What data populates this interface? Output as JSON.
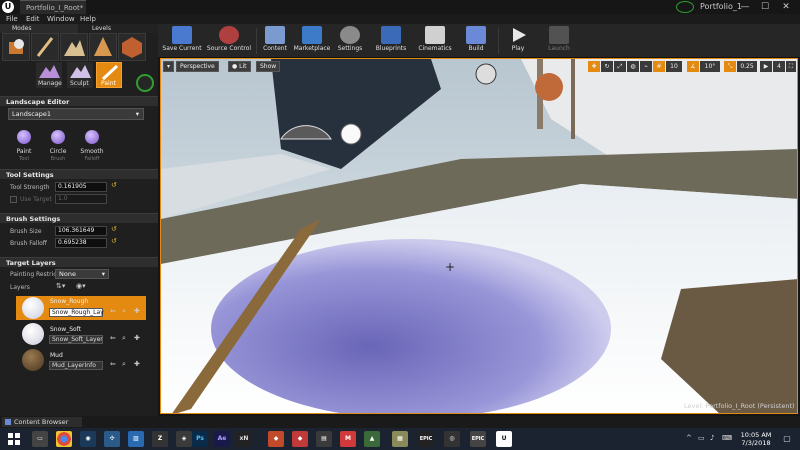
{
  "window": {
    "tab_title": "Portfolio_I_Root*",
    "project_name": "Portfolio_1",
    "controls": {
      "minimize": "—",
      "maximize": "☐",
      "close": "✕"
    }
  },
  "menu": [
    "File",
    "Edit",
    "Window",
    "Help"
  ],
  "panel_tabs": {
    "modes": "Modes",
    "levels": "Levels"
  },
  "modes": {
    "manage": "Manage",
    "sculpt": "Sculpt",
    "paint": "Paint"
  },
  "landscape_editor": {
    "title": "Landscape Editor",
    "selected_landscape": "Landscape1",
    "tools": [
      {
        "label": "Paint",
        "sub": "Tool"
      },
      {
        "label": "Circle",
        "sub": "Brush"
      },
      {
        "label": "Smooth",
        "sub": "Falloff"
      }
    ]
  },
  "tool_settings": {
    "title": "Tool Settings",
    "strength_label": "Tool Strength",
    "strength_value": "0.161905",
    "target_label": "Use Target",
    "target_value": "1.0"
  },
  "brush_settings": {
    "title": "Brush Settings",
    "size_label": "Brush Size",
    "size_value": "106.361649",
    "falloff_label": "Brush Falloff",
    "falloff_value": "0.695238"
  },
  "target_layers": {
    "title": "Target Layers",
    "painting_restriction_label": "Painting Restric",
    "painting_restriction_value": "None",
    "layers_label": "Layers",
    "layers": [
      {
        "name": "Snow_Rough",
        "info": "Snow_Rough_Lay",
        "selected": true
      },
      {
        "name": "Snow_Soft",
        "info": "Snow_Soft_Layer"
      },
      {
        "name": "Mud",
        "info": "Mud_LayerInfo"
      }
    ]
  },
  "toolbar": {
    "buttons": [
      "Save Current",
      "Source Control",
      "Content",
      "Marketplace",
      "Settings",
      "Blueprints",
      "Cinematics",
      "Build",
      "Play",
      "Launch"
    ]
  },
  "viewport": {
    "perspective": "Perspective",
    "lit": "Lit",
    "show": "Show",
    "grid_snap": "10",
    "rotation_snap": "10°",
    "scale_snap": "0.25",
    "camera_speed": "4",
    "level_text": "Level: Portfolio_I_Root (Persistent)"
  },
  "content_browser": {
    "tab": "Content Browser"
  },
  "taskbar": {
    "apps": [
      "Ps",
      "Ae",
      "xN",
      "EPIC"
    ],
    "time": "10:05 AM",
    "date": "7/3/2018"
  },
  "colors": {
    "accent": "#e58a10",
    "panel": "#1f1f1f",
    "selected_layer": "#e58a10"
  }
}
